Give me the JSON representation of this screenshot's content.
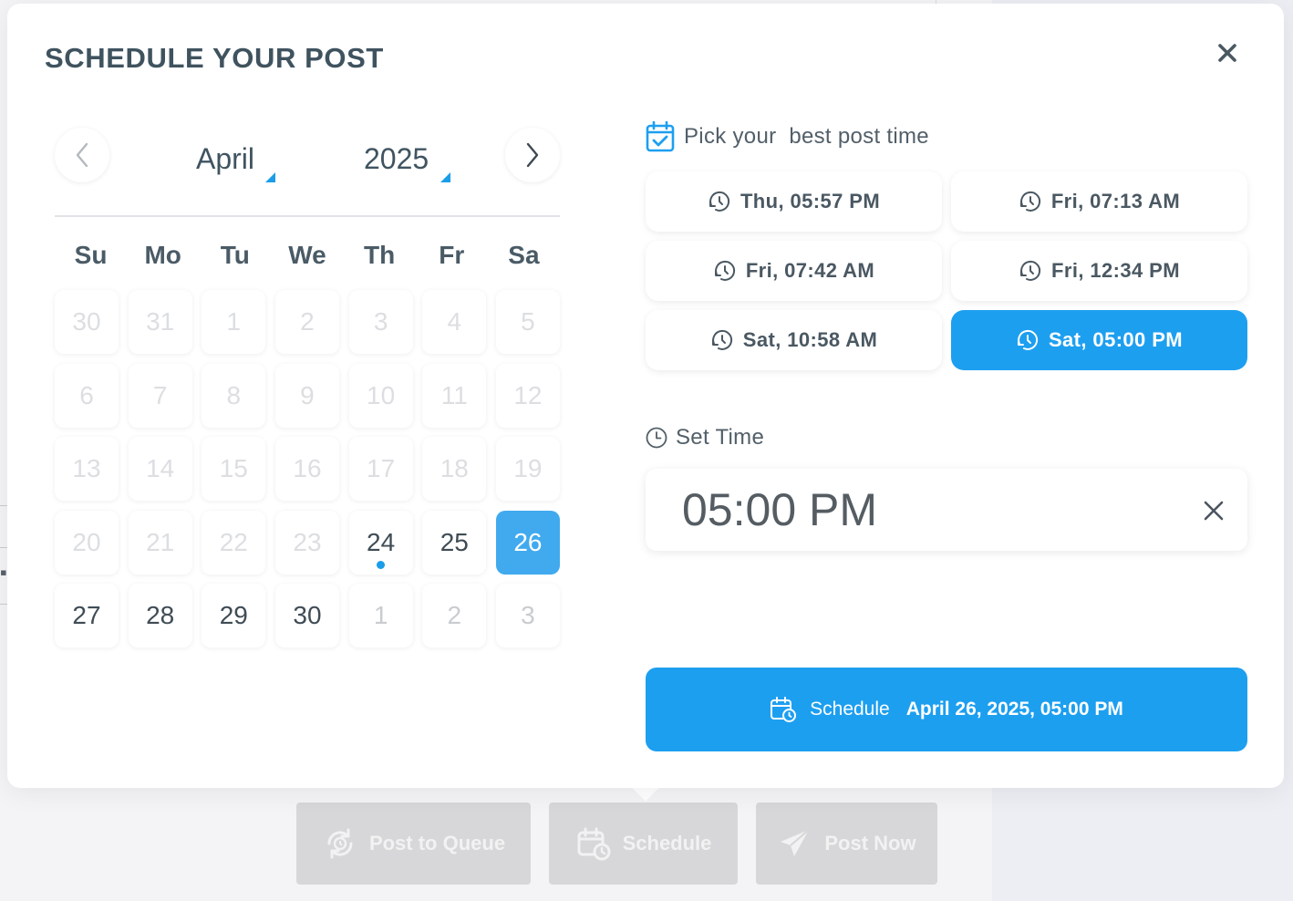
{
  "modal": {
    "title": "SCHEDULE YOUR POST"
  },
  "calendar": {
    "month": "April",
    "year": "2025",
    "weekdays": [
      "Su",
      "Mo",
      "Tu",
      "We",
      "Th",
      "Fr",
      "Sa"
    ],
    "days": [
      {
        "label": "30",
        "state": "disabled"
      },
      {
        "label": "31",
        "state": "disabled"
      },
      {
        "label": "1",
        "state": "disabled"
      },
      {
        "label": "2",
        "state": "disabled"
      },
      {
        "label": "3",
        "state": "disabled"
      },
      {
        "label": "4",
        "state": "disabled"
      },
      {
        "label": "5",
        "state": "disabled"
      },
      {
        "label": "6",
        "state": "disabled"
      },
      {
        "label": "7",
        "state": "disabled"
      },
      {
        "label": "8",
        "state": "disabled"
      },
      {
        "label": "9",
        "state": "disabled"
      },
      {
        "label": "10",
        "state": "disabled"
      },
      {
        "label": "11",
        "state": "disabled"
      },
      {
        "label": "12",
        "state": "disabled"
      },
      {
        "label": "13",
        "state": "disabled"
      },
      {
        "label": "14",
        "state": "disabled"
      },
      {
        "label": "15",
        "state": "disabled"
      },
      {
        "label": "16",
        "state": "disabled"
      },
      {
        "label": "17",
        "state": "disabled"
      },
      {
        "label": "18",
        "state": "disabled"
      },
      {
        "label": "19",
        "state": "disabled"
      },
      {
        "label": "20",
        "state": "disabled"
      },
      {
        "label": "21",
        "state": "disabled"
      },
      {
        "label": "22",
        "state": "disabled"
      },
      {
        "label": "23",
        "state": "disabled"
      },
      {
        "label": "24",
        "state": "today"
      },
      {
        "label": "25",
        "state": "enabled"
      },
      {
        "label": "26",
        "state": "selected"
      },
      {
        "label": "27",
        "state": "enabled"
      },
      {
        "label": "28",
        "state": "enabled"
      },
      {
        "label": "29",
        "state": "enabled"
      },
      {
        "label": "30",
        "state": "enabled"
      },
      {
        "label": "1",
        "state": "muted"
      },
      {
        "label": "2",
        "state": "muted"
      },
      {
        "label": "3",
        "state": "muted"
      }
    ]
  },
  "best_time": {
    "label": "Pick your  best post time",
    "icon": "calendar-check-icon",
    "slots": [
      {
        "label": "Thu, 05:57 PM",
        "active": false
      },
      {
        "label": "Fri, 07:13 AM",
        "active": false
      },
      {
        "label": "Fri, 07:42 AM",
        "active": false
      },
      {
        "label": "Fri, 12:34 PM",
        "active": false
      },
      {
        "label": "Sat, 10:58 AM",
        "active": false
      },
      {
        "label": "Sat, 05:00 PM",
        "active": true
      }
    ]
  },
  "set_time": {
    "label": "Set Time",
    "value": "05:00 PM"
  },
  "schedule_button": {
    "label": "Schedule",
    "when": "April 26, 2025, 05:00 PM"
  },
  "background_actions": {
    "post_to_queue": "Post to Queue",
    "schedule": "Schedule",
    "post_now": "Post Now"
  },
  "colors": {
    "accent": "#1d9ff0",
    "selected_day": "#41aaef",
    "title": "#3f535f"
  }
}
